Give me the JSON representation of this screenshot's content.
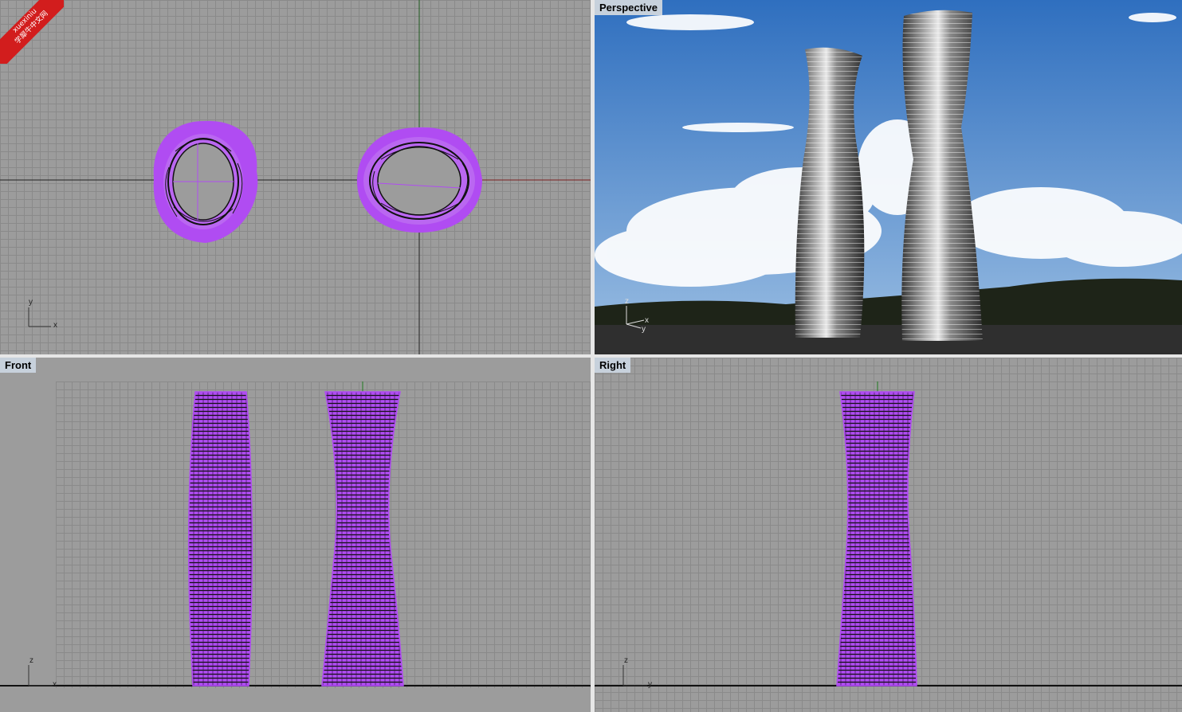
{
  "watermark": {
    "line1": "xuexiniu",
    "line2": "学犀牛中文网"
  },
  "viewports": {
    "top": {
      "label": "",
      "axis_a": "y",
      "axis_b": "x"
    },
    "perspective": {
      "label": "Perspective",
      "axis_a": "z",
      "axis_b": "x",
      "axis_c": "y"
    },
    "front": {
      "label": "Front",
      "axis_a": "z",
      "axis_b": "x"
    },
    "right": {
      "label": "Right",
      "axis_a": "z",
      "axis_b": "y"
    }
  },
  "colors": {
    "selection": "#b04cf2",
    "grid_bg": "#9c9c9c",
    "grid_line": "#8a8a8a",
    "label_bg": "#c7d1dc",
    "sky": "#5b8fc9"
  }
}
